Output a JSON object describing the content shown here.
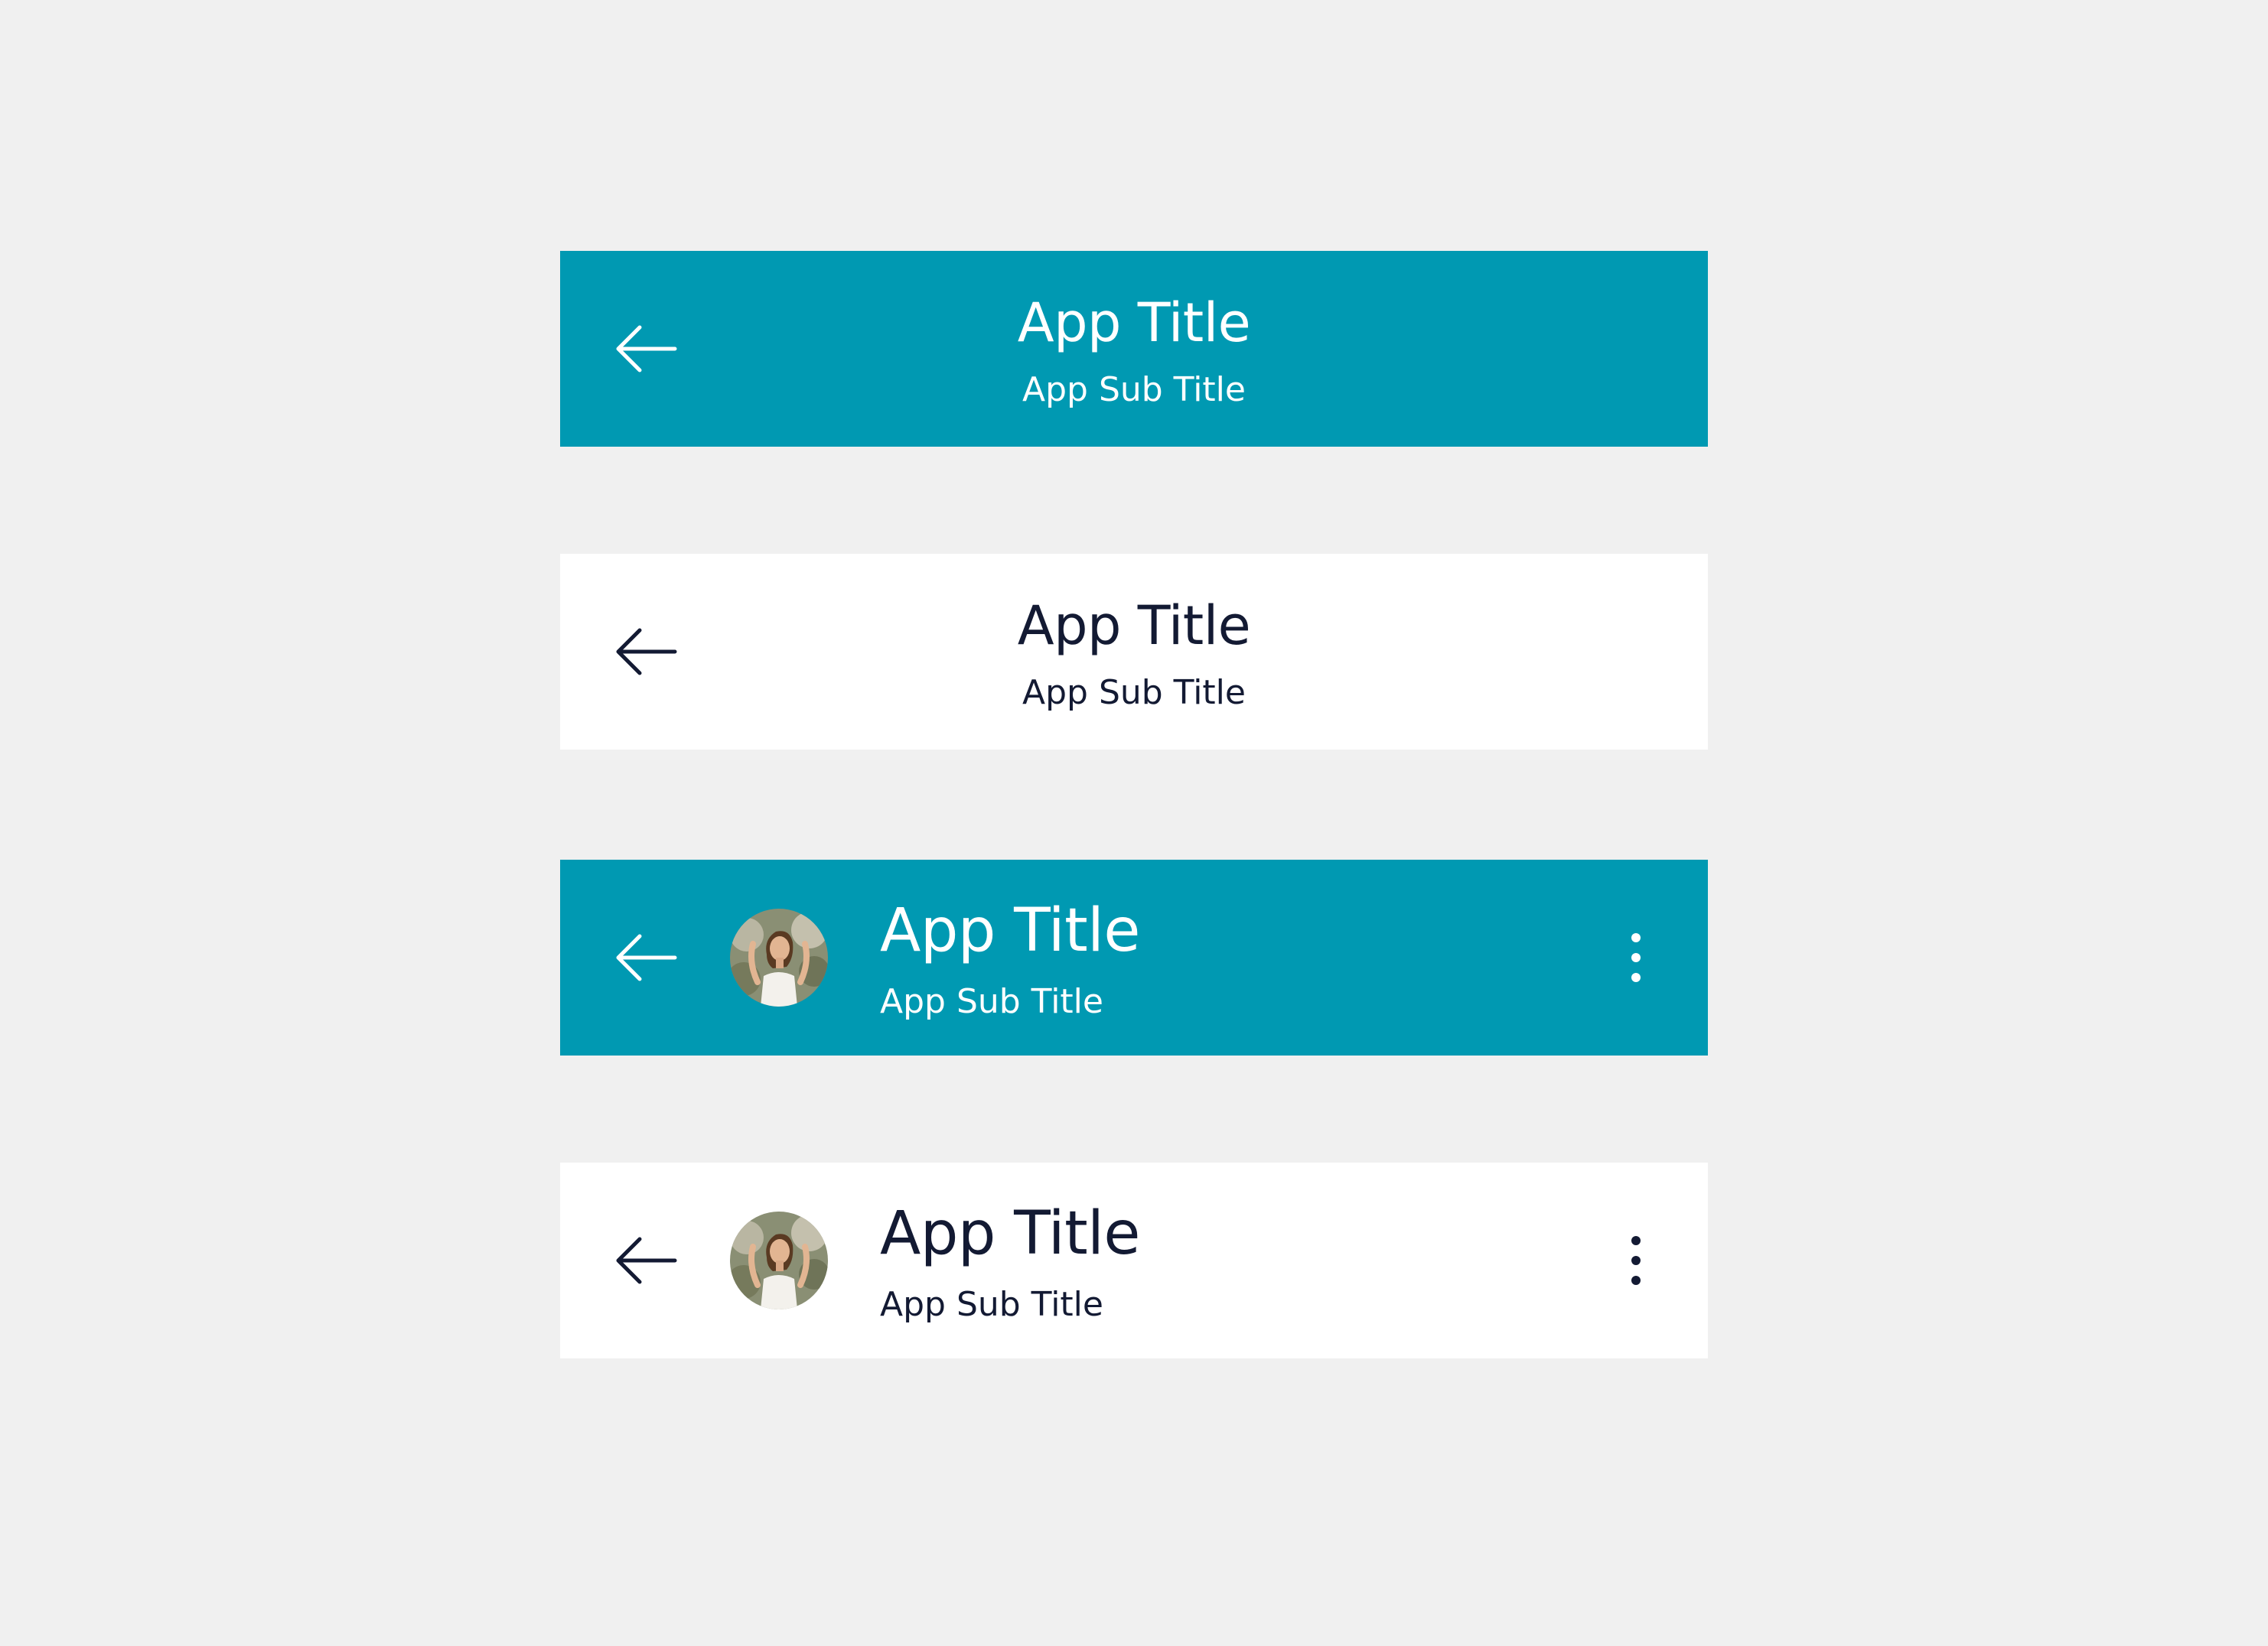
{
  "colors": {
    "page_background": "#f0f0f0",
    "teal": "#0099b2",
    "white": "#ffffff",
    "dark_text": "#131a33"
  },
  "app_bars": [
    {
      "variant": "teal-centered",
      "back_icon": "arrow-left-icon",
      "title": "App Title",
      "subtitle": "App Sub Title"
    },
    {
      "variant": "white-centered",
      "back_icon": "arrow-left-icon",
      "title": "App Title",
      "subtitle": "App Sub Title"
    },
    {
      "variant": "teal-with-avatar",
      "back_icon": "arrow-left-icon",
      "avatar": "avatar-photo",
      "title": "App Title",
      "subtitle": "App Sub Title",
      "menu_icon": "more-vertical-icon"
    },
    {
      "variant": "white-with-avatar",
      "back_icon": "arrow-left-icon",
      "avatar": "avatar-photo",
      "title": "App Title",
      "subtitle": "App Sub Title",
      "menu_icon": "more-vertical-icon"
    }
  ]
}
